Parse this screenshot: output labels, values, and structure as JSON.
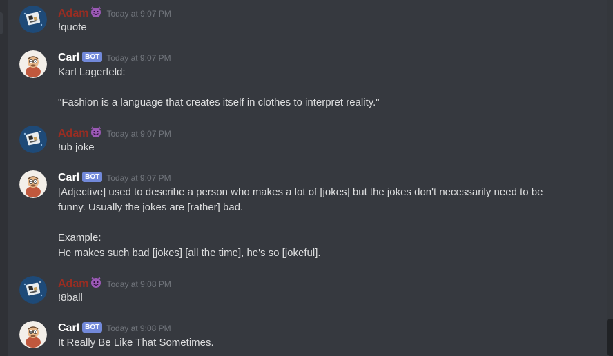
{
  "messages": [
    {
      "author": "Adam",
      "author_color": "#992d22",
      "is_bot": false,
      "badge_emoji": "smiling-imp-icon",
      "timestamp": "Today at 9:07 PM",
      "content": "!quote"
    },
    {
      "author": "Carl",
      "is_bot": true,
      "bot_label": "BOT",
      "timestamp": "Today at 9:07 PM",
      "content": "Karl Lagerfeld:\n\n\"Fashion is a language that creates itself in clothes to interpret reality.\""
    },
    {
      "author": "Adam",
      "author_color": "#992d22",
      "is_bot": false,
      "badge_emoji": "smiling-imp-icon",
      "timestamp": "Today at 9:07 PM",
      "content": "!ub joke"
    },
    {
      "author": "Carl",
      "is_bot": true,
      "bot_label": "BOT",
      "timestamp": "Today at 9:07 PM",
      "content": "[Adjective] used to describe a person who makes a lot of [jokes] but the jokes don't necessarily need to be funny. Usually the jokes are [rather] bad.\n\nExample:\nHe makes such bad [jokes] [all the time], he's so [jokeful]."
    },
    {
      "author": "Adam",
      "author_color": "#992d22",
      "is_bot": false,
      "badge_emoji": "smiling-imp-icon",
      "timestamp": "Today at 9:08 PM",
      "content": "!8ball"
    },
    {
      "author": "Carl",
      "is_bot": true,
      "bot_label": "BOT",
      "timestamp": "Today at 9:08 PM",
      "content": "It Really Be Like That Sometimes."
    }
  ],
  "colors": {
    "background": "#36393f",
    "text": "#dcddde",
    "timestamp": "#72767d",
    "bot_tag": "#7289da",
    "imp_emoji": "#9b59b6"
  }
}
